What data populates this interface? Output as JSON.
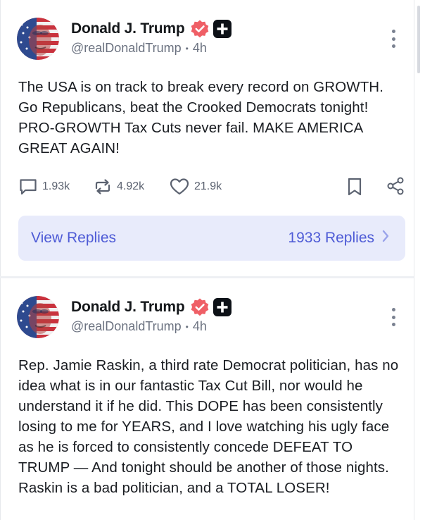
{
  "posts": [
    {
      "author": {
        "display_name": "Donald J. Trump",
        "handle": "@realDonaldTrump",
        "time": "4h",
        "verified_icon": "verified-badge-icon",
        "badge_icon": "plus-badge-icon"
      },
      "text": "The USA is on track to break every record on GROWTH. Go Republicans, beat the Crooked Democrats tonight! PRO-GROWTH Tax Cuts never fail. MAKE AMERICA GREAT AGAIN!",
      "stats": {
        "replies": "1.93k",
        "retruths": "4.92k",
        "likes": "21.9k"
      },
      "replies_bar": {
        "label": "View Replies",
        "count_label": "1933 Replies"
      }
    },
    {
      "author": {
        "display_name": "Donald J. Trump",
        "handle": "@realDonaldTrump",
        "time": "4h",
        "verified_icon": "verified-badge-icon",
        "badge_icon": "plus-badge-icon"
      },
      "text": "Rep. Jamie Raskin, a third rate Democrat politician, has no idea what is in our fantastic Tax Cut Bill, nor would he understand it if he did. This DOPE has been consistently losing to me for YEARS, and I love watching his ugly face as he is forced to consistently concede DEFEAT TO TRUMP — And tonight should be another of those nights. Raskin is a bad politician, and a TOTAL LOSER!"
    }
  ],
  "colors": {
    "accent": "#4e5bd6",
    "replies_bg": "#e8ebfb",
    "verified": "#ef5f66",
    "muted": "#6b7280"
  }
}
